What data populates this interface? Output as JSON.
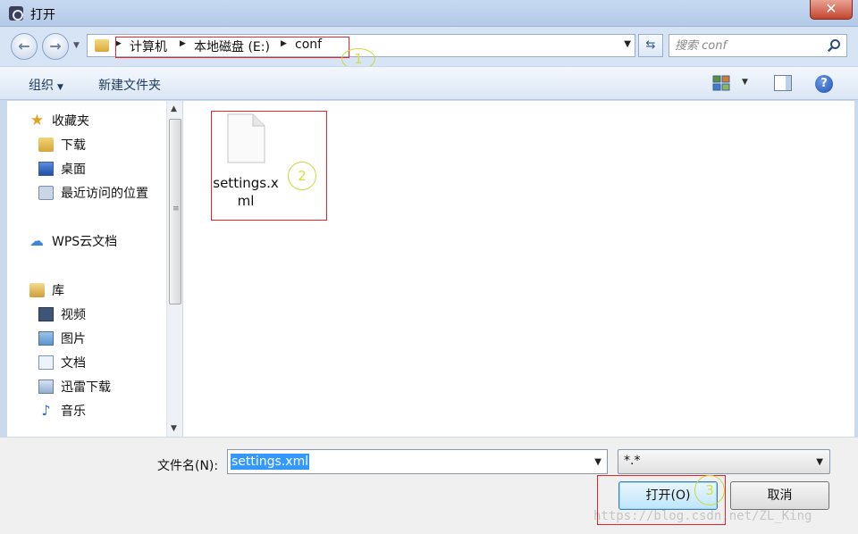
{
  "window": {
    "title": "打开",
    "close_label": "✕"
  },
  "address": {
    "breadcrumbs": [
      "计算机",
      "本地磁盘 (E:)",
      "conf"
    ],
    "search_placeholder": "搜索 conf"
  },
  "toolbar": {
    "organize": "组织",
    "new_folder": "新建文件夹",
    "help": "?"
  },
  "nav": {
    "favorites": "收藏夹",
    "downloads": "下载",
    "desktop": "桌面",
    "recent": "最近访问的位置",
    "wps_cloud": "WPS云文档",
    "libraries": "库",
    "videos": "视频",
    "pictures": "图片",
    "documents": "文档",
    "thunder": "迅雷下载",
    "music": "音乐"
  },
  "content": {
    "files": [
      {
        "name": "settings.xml"
      }
    ]
  },
  "bottom": {
    "filename_label": "文件名(N):",
    "filename_value": "settings.xml",
    "filter_value": "*.*",
    "open_button": "打开(O)",
    "cancel_button": "取消"
  },
  "annotations": {
    "one": "1",
    "two": "2",
    "three": "3"
  },
  "watermark": "https://blog.csdn.net/ZL_King",
  "colors": {
    "annotation_box": "#e8262a",
    "annotation_circle": "#d7e03a",
    "selection": "#3399ff"
  }
}
